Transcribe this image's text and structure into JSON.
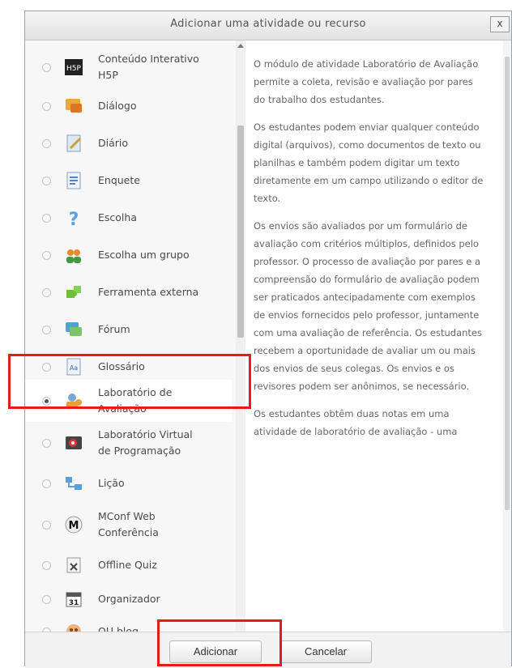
{
  "dialog": {
    "title": "Adicionar uma atividade ou recurso",
    "close_label": "x"
  },
  "activities": [
    {
      "line1": "Conteúdo Interativo",
      "line2": "H5P",
      "icon": "h5p-icon",
      "selected": false
    },
    {
      "line1": "Diálogo",
      "line2": "",
      "icon": "dialog-icon",
      "selected": false
    },
    {
      "line1": "Diário",
      "line2": "",
      "icon": "journal-icon",
      "selected": false
    },
    {
      "line1": "Enquete",
      "line2": "",
      "icon": "survey-icon",
      "selected": false
    },
    {
      "line1": "Escolha",
      "line2": "",
      "icon": "question-icon",
      "selected": false
    },
    {
      "line1": "Escolha um grupo",
      "line2": "",
      "icon": "group-icon",
      "selected": false
    },
    {
      "line1": "Ferramenta externa",
      "line2": "",
      "icon": "puzzle-icon",
      "selected": false
    },
    {
      "line1": "Fórum",
      "line2": "",
      "icon": "forum-icon",
      "selected": false
    },
    {
      "line1": "Glossário",
      "line2": "",
      "icon": "glossary-icon",
      "selected": false
    },
    {
      "line1": "Laboratório de",
      "line2": "Avaliação",
      "icon": "workshop-icon",
      "selected": true
    },
    {
      "line1": "Laboratório Virtual",
      "line2": "de Programação",
      "icon": "vpl-icon",
      "selected": false
    },
    {
      "line1": "Lição",
      "line2": "",
      "icon": "lesson-icon",
      "selected": false
    },
    {
      "line1": "MConf Web",
      "line2": "Conferência",
      "icon": "mconf-icon",
      "selected": false
    },
    {
      "line1": "Offline Quiz",
      "line2": "",
      "icon": "offline-quiz-icon",
      "selected": false
    },
    {
      "line1": "Organizador",
      "line2": "",
      "icon": "calendar-icon",
      "selected": false
    },
    {
      "line1": "OU blog",
      "line2": "",
      "icon": "blog-icon",
      "selected": false
    }
  ],
  "description": {
    "paragraphs": [
      "O módulo de atividade Laboratório de Avaliação permite a coleta, revisão e avaliação por pares do trabalho dos estudantes.",
      "Os estudantes podem enviar qualquer conteúdo digital (arquivos), como documentos de texto ou planilhas e também podem digitar um texto diretamente em um campo utilizando o editor de texto.",
      "Os envios são avaliados por um formulário de avaliação com critérios múltiplos, definidos pelo professor. O processo de avaliação por pares e a compreensão do formulário de avaliação podem ser praticados antecipadamente com exemplos de envios fornecidos pelo professor, juntamente com uma avaliação de referência. Os estudantes recebem a oportunidade de avaliar um ou mais dos envios de seus colegas. Os envios e os revisores podem ser anônimos, se necessário.",
      "Os estudantes obtêm duas notas em uma atividade de laboratório de avaliação - uma"
    ]
  },
  "footer": {
    "add_label": "Adicionar",
    "cancel_label": "Cancelar"
  }
}
